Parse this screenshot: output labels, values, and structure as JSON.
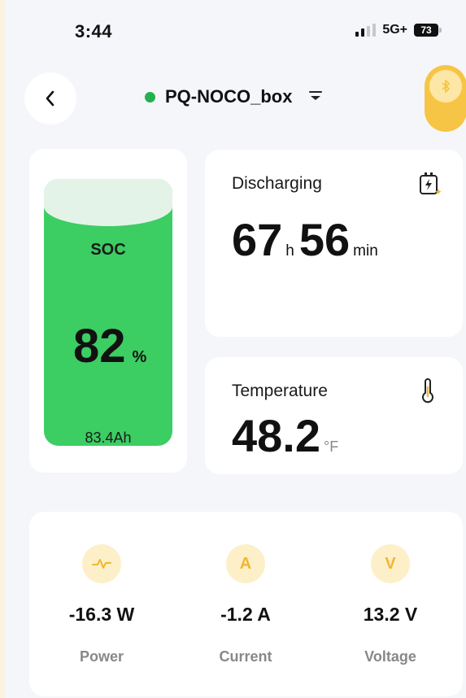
{
  "status_bar": {
    "time": "3:44",
    "network": "5G+",
    "battery": "73"
  },
  "header": {
    "device_name": "PQ-NOCO_box"
  },
  "soc": {
    "label": "SOC",
    "value": "82",
    "unit": "%",
    "capacity": "83.4Ah",
    "level_percent": 82
  },
  "discharging": {
    "title": "Discharging",
    "hours": "67",
    "hours_unit": "h",
    "minutes": "56",
    "minutes_unit": "min"
  },
  "temperature": {
    "title": "Temperature",
    "value": "48.2",
    "unit": "°F"
  },
  "stats": [
    {
      "icon": "pulse-icon",
      "icon_text": "",
      "value": "-16.3 W",
      "label": "Power"
    },
    {
      "icon": "ampere-icon",
      "icon_text": "A",
      "value": "-1.2 A",
      "label": "Current"
    },
    {
      "icon": "volt-icon",
      "icon_text": "V",
      "value": "13.2 V",
      "label": "Voltage"
    }
  ],
  "colors": {
    "accent": "#f7c545",
    "soc_fill": "#3ccd63",
    "online": "#22b14c"
  }
}
